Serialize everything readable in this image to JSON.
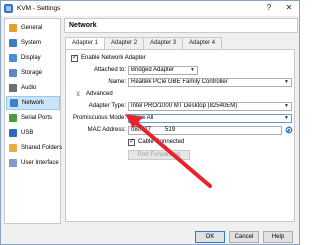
{
  "window": {
    "title": "KVM - Settings",
    "help": "?",
    "close": "✕"
  },
  "sidebar": {
    "items": [
      {
        "label": "General",
        "icon": "general-icon",
        "color": "#e0a030"
      },
      {
        "label": "System",
        "icon": "system-icon",
        "color": "#3c7fc4"
      },
      {
        "label": "Display",
        "icon": "display-icon",
        "color": "#4a8fd6"
      },
      {
        "label": "Storage",
        "icon": "storage-icon",
        "color": "#5a8ac0"
      },
      {
        "label": "Audio",
        "icon": "audio-icon",
        "color": "#6f6f6f"
      },
      {
        "label": "Network",
        "icon": "network-icon",
        "color": "#3f7fd0",
        "selected": true
      },
      {
        "label": "Serial Ports",
        "icon": "serial-ports-icon",
        "color": "#4d9c3a"
      },
      {
        "label": "USB",
        "icon": "usb-icon",
        "color": "#3069b8"
      },
      {
        "label": "Shared Folders",
        "icon": "shared-folders-icon",
        "color": "#e0b040"
      },
      {
        "label": "User Interface",
        "icon": "user-interface-icon",
        "color": "#7b9cc8"
      }
    ]
  },
  "section": {
    "title": "Network"
  },
  "tabs": [
    "Adapter 1",
    "Adapter 2",
    "Adapter 3",
    "Adapter 4"
  ],
  "adapter": {
    "enable_label": "Enable Network Adapter",
    "attached_label": "Attached to:",
    "attached_value": "Bridged Adapter",
    "name_label": "Name:",
    "name_value": "Realtek PCIe GBE Family Controller",
    "advanced_label": "Advanced",
    "type_label": "Adapter Type:",
    "type_value": "Intel PRO/1000 MT Desktop (82540EM)",
    "promisc_label": "Promiscuous Mode:",
    "promisc_value": "Allow All",
    "mac_label": "MAC Address:",
    "mac_value": "080027",
    "mac_value_end": "519",
    "cable_label": "Cable Connected",
    "port_forwarding_label": "Port Forwarding"
  },
  "footer": {
    "ok": "OK",
    "cancel": "Cancel",
    "help": "Help"
  },
  "colors": {
    "accent": "#cce4f7",
    "annotation_arrow": "#e8222a"
  }
}
